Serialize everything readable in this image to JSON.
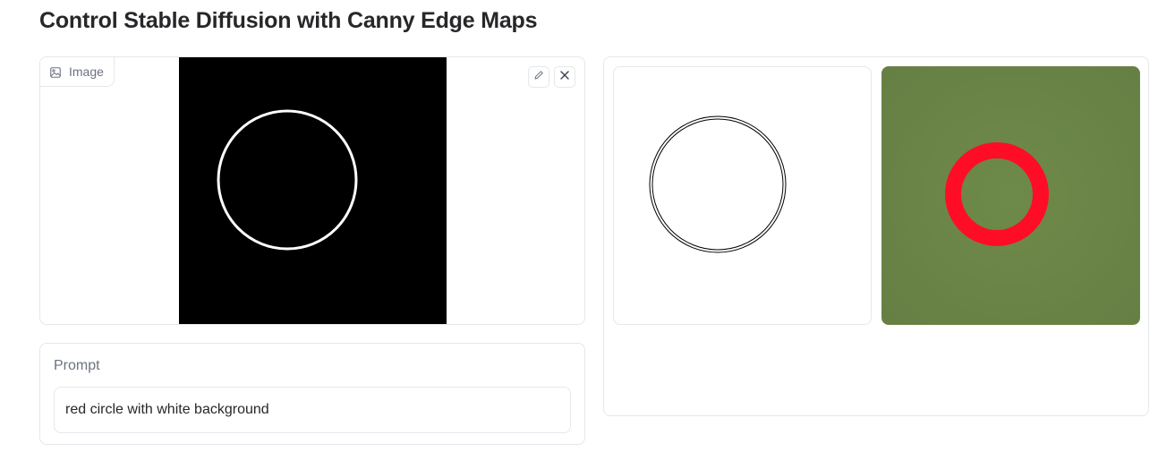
{
  "page": {
    "title": "Control Stable Diffusion with Canny Edge Maps"
  },
  "image_input": {
    "label": "Image",
    "label_icon": "image-icon",
    "edit_icon": "pencil-icon",
    "clear_icon": "close-icon"
  },
  "prompt": {
    "label": "Prompt",
    "value": "red circle with white background"
  },
  "gallery": {
    "items": [
      {
        "name": "canny-edge-map-output",
        "background": "#ffffff"
      },
      {
        "name": "generated-image-output",
        "background": "#6b8447",
        "ring_color": "#ff0d26"
      }
    ]
  },
  "colors": {
    "border": "#e5e7eb",
    "label_text": "#6b7280",
    "title_text": "#27272a",
    "ring": "#ff0d26",
    "generated_background": "#6b8447"
  }
}
